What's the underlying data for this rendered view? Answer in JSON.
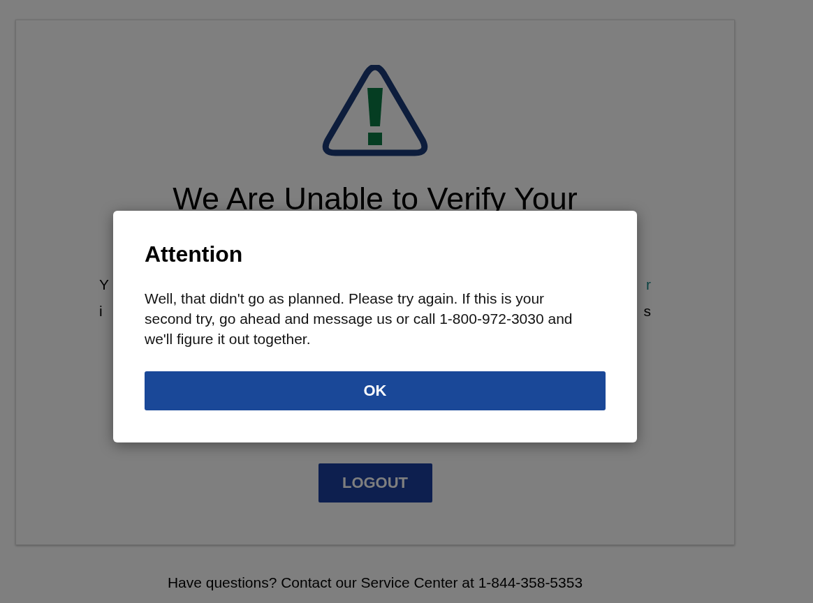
{
  "page": {
    "heading": "We Are Unable to Verify Your",
    "paragraph_fragments": [
      {
        "start": "Y",
        "end": "r"
      },
      {
        "start": "i",
        "end": "s"
      }
    ],
    "logout_button": "LOGOUT",
    "footer": "Have questions? Contact our Service Center at 1-844-358-5353"
  },
  "dialog": {
    "title": "Attention",
    "message": "Well, that didn't go as planned. Please try again. If this is your second try, go ahead and message us or call 1-800-972-3030 and we'll figure it out together.",
    "button": "OK"
  }
}
